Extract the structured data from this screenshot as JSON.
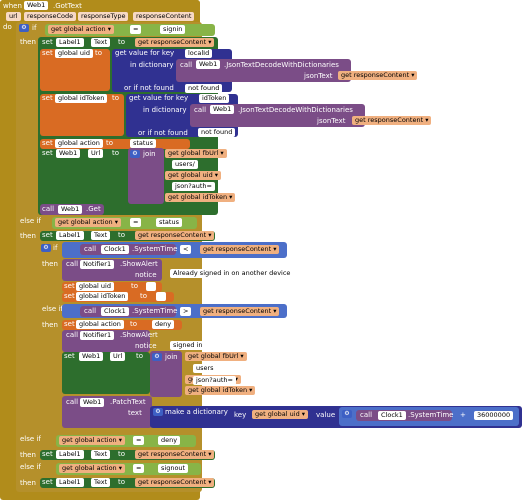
{
  "event": {
    "when": "when",
    "component": "Web1",
    "event_name": ".GotText",
    "params": [
      "url",
      "responseCode",
      "responseType",
      "responseContent"
    ]
  },
  "kw": {
    "do": "do",
    "if": "if",
    "then": "then",
    "else_if": "else if",
    "else": "else",
    "set": "set",
    "get": "get",
    "to": "to",
    "call": "call",
    "join": "join",
    "text": "text",
    "notice": "notice",
    "key": "key",
    "value": "value",
    "make_dict": "make a dictionary",
    "get_value_for_key": "get value for key",
    "in_dictionary": "in dictionary",
    "or_if_not_found": "or if not found",
    "jsonText": "jsonText"
  },
  "ops": {
    "eq": "=",
    "lt": "<",
    "gt": ">",
    "plus": "+"
  },
  "vars": {
    "global_action": "global action",
    "global_uid": "global uid",
    "global_idToken": "global idToken",
    "global_fbUrl": "global fbUrl",
    "responseContent": "responseContent"
  },
  "comps": {
    "Web1": "Web1",
    "Label1": "Label1",
    "Clock1": "Clock1",
    "Notifier1": "Notifier1"
  },
  "props": {
    "Text": "Text",
    "Url": "Url"
  },
  "methods": {
    "decode": ".JsonTextDecodeWithDictionaries",
    "get": ".Get",
    "system_time": ".SystemTime",
    "show_alert": ".ShowAlert",
    "patch_text": ".PatchText"
  },
  "strings": {
    "signin": "signin",
    "localId": "localId",
    "not_found": "not found",
    "idToken": "idToken",
    "status": "status",
    "users": "users/",
    "json_auth": "json?auth=",
    "already_signed": "Already signed in on another device",
    "empty": "",
    "deny": "deny",
    "signed_in": "signed in",
    "users2": "users",
    "signout": "signout"
  },
  "numbers": {
    "ms": "36000000"
  }
}
